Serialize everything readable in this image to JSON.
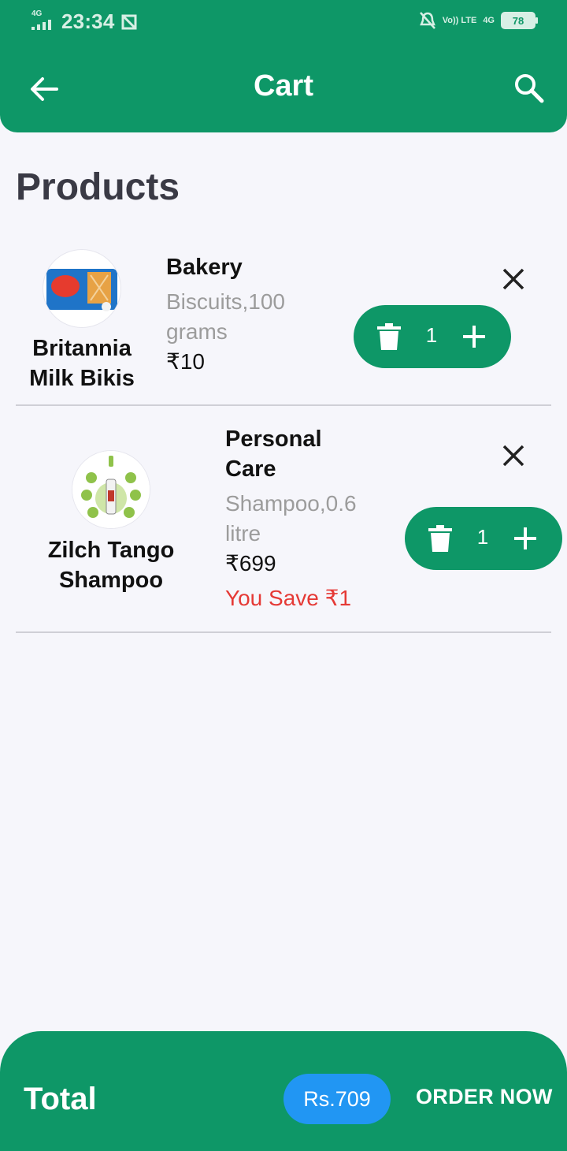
{
  "status_bar": {
    "network": "4G",
    "time": "23:34",
    "volte": "Vo)) LTE",
    "net_right": "4G",
    "battery": "78"
  },
  "header": {
    "title": "Cart",
    "back_icon": "arrow-left-icon",
    "search_icon": "search-icon"
  },
  "section": {
    "title": "Products"
  },
  "items": [
    {
      "name": "Britannia Milk Bikis",
      "category": "Bakery",
      "description": "Biscuits,100 grams",
      "price": "₹10",
      "savings": "",
      "quantity": "1"
    },
    {
      "name": "Zilch Tango Shampoo",
      "category": "Personal Care",
      "description": "Shampoo,0.6 litre",
      "price": "₹699",
      "savings": "You Save ₹1",
      "quantity": "1"
    }
  ],
  "footer": {
    "total_label": "Total",
    "total_value": "Rs.709",
    "order_button": "ORDER NOW"
  },
  "colors": {
    "primary": "#0e9767",
    "accent_blue": "#2196f3",
    "savings_red": "#e53935",
    "background": "#f6f6fb"
  }
}
